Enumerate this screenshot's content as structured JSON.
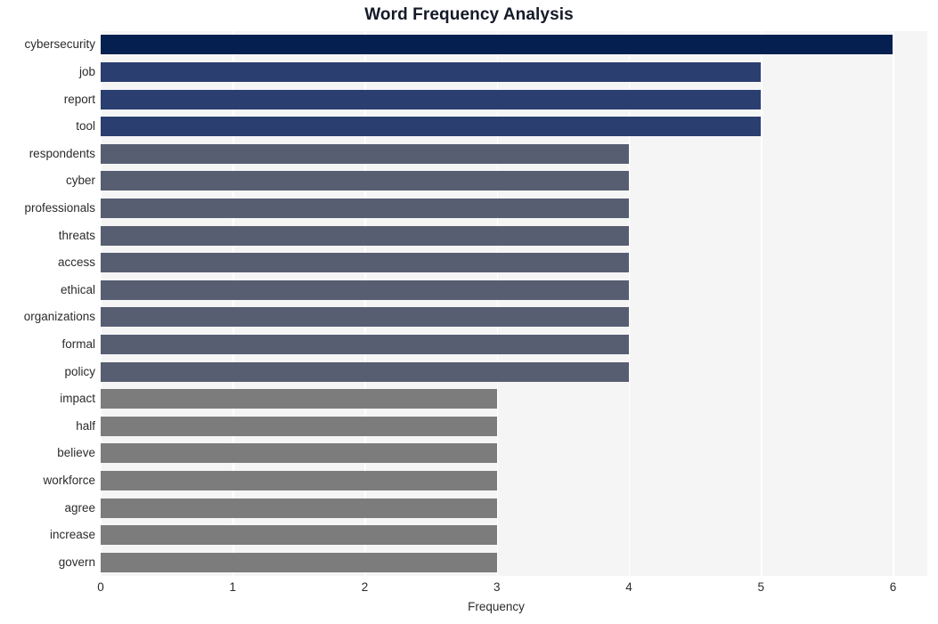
{
  "chart_data": {
    "type": "bar",
    "orientation": "horizontal",
    "title": "Word Frequency Analysis",
    "xlabel": "Frequency",
    "ylabel": "",
    "categories": [
      "cybersecurity",
      "job",
      "report",
      "tool",
      "respondents",
      "cyber",
      "professionals",
      "threats",
      "access",
      "ethical",
      "organizations",
      "formal",
      "policy",
      "impact",
      "half",
      "believe",
      "workforce",
      "agree",
      "increase",
      "govern"
    ],
    "values": [
      6,
      5,
      5,
      5,
      4,
      4,
      4,
      4,
      4,
      4,
      4,
      4,
      4,
      3,
      3,
      3,
      3,
      3,
      3,
      3
    ],
    "bar_colors": [
      "#052050",
      "#2b3e70",
      "#2b3e70",
      "#2b3e70",
      "#585e72",
      "#585e72",
      "#585e72",
      "#585e72",
      "#585e72",
      "#585e72",
      "#585e72",
      "#585e72",
      "#585e72",
      "#7c7c7c",
      "#7c7c7c",
      "#7c7c7c",
      "#7c7c7c",
      "#7c7c7c",
      "#7c7c7c",
      "#7c7c7c"
    ],
    "xlim": [
      0,
      6.26
    ],
    "xticks": [
      0,
      1,
      2,
      3,
      4,
      5,
      6
    ],
    "xtick_labels": [
      "0",
      "1",
      "2",
      "3",
      "4",
      "5",
      "6"
    ],
    "grid": true,
    "grid_axis": "x",
    "grid_color": "#ffffff",
    "legend": null,
    "plot_background": "#f5f5f6",
    "figure_background": "#ffffff",
    "title_color": "#151a28",
    "tick_color": "#2b2b2b"
  }
}
